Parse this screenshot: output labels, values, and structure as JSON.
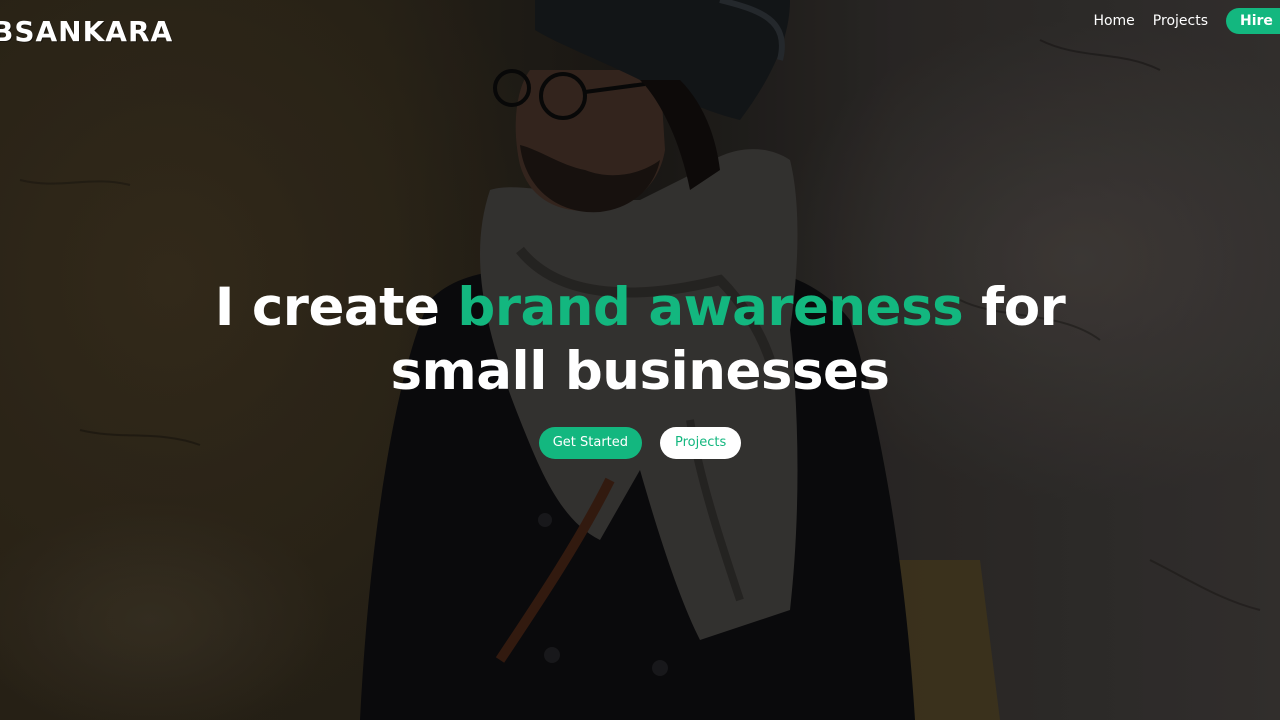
{
  "brand": {
    "logo_text": "BSANKARA"
  },
  "nav": {
    "items": [
      {
        "label": "Home"
      },
      {
        "label": "Projects"
      }
    ],
    "hire_label": "Hire"
  },
  "hero": {
    "headline_line1_prefix": "I create ",
    "headline_accent": "brand awareness",
    "headline_line1_suffix": " for",
    "headline_line2": "small businesses",
    "primary_cta": "Get Started",
    "secondary_cta": "Projects"
  },
  "colors": {
    "accent": "#13b77f",
    "text": "#ffffff",
    "background": "#1c1a17"
  }
}
